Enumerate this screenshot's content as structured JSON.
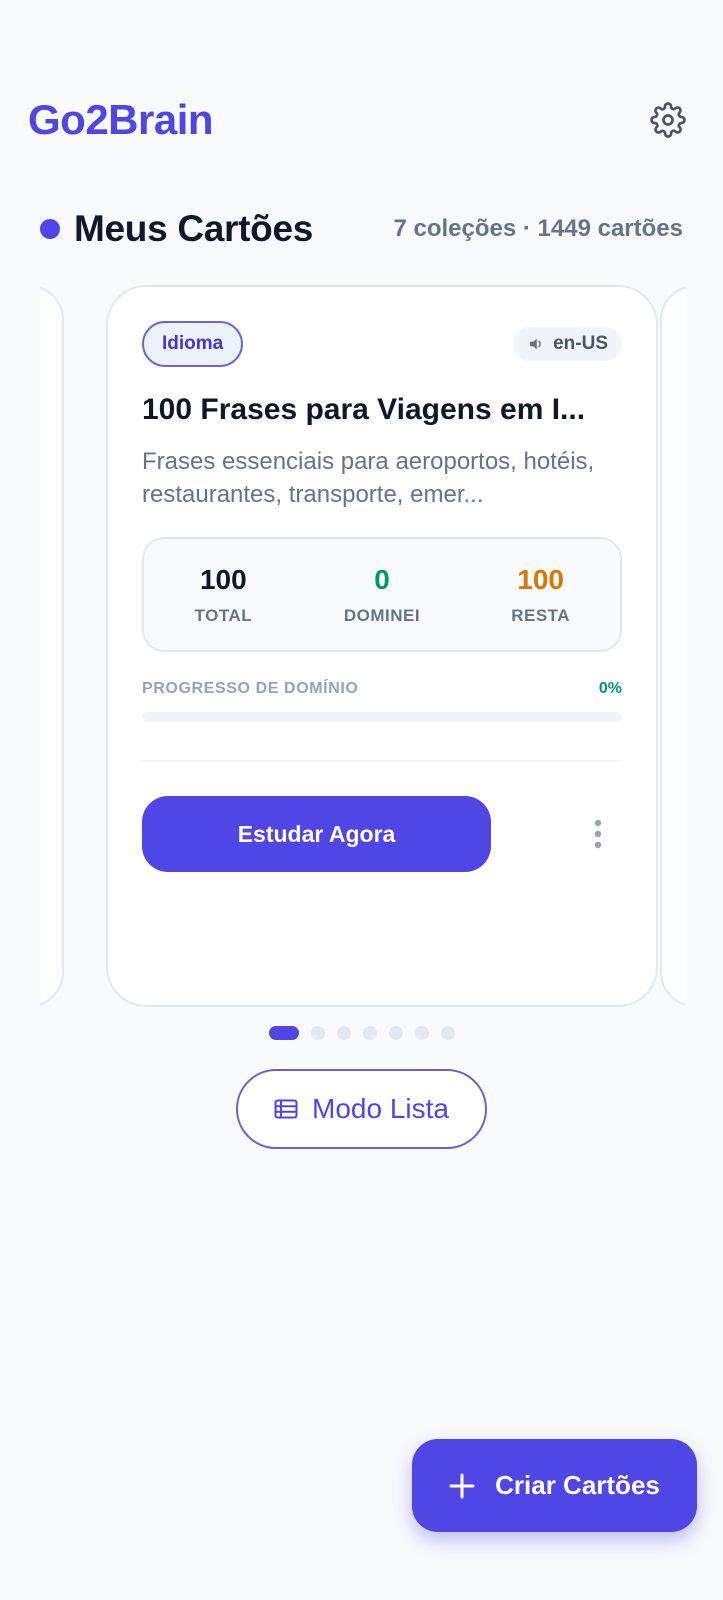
{
  "app": {
    "title": "Go2Brain"
  },
  "header": {
    "settings_icon": "gear-icon"
  },
  "section": {
    "title": "Meus Cartões",
    "meta": "7 coleções · 1449 cartões"
  },
  "card": {
    "badge": "Idioma",
    "language": "en-US",
    "title": "100 Frases para Viagens em I...",
    "description": "Frases essenciais para aeroportos, hotéis, restaurantes, transporte, emer...",
    "stats": {
      "total_value": "100",
      "total_label": "TOTAL",
      "mastered_value": "0",
      "mastered_label": "DOMINEI",
      "remaining_value": "100",
      "remaining_label": "RESTA"
    },
    "progress": {
      "label": "PROGRESSO DE DOMÍNIO",
      "percent_text": "0%",
      "fraction": 0
    },
    "study_button": "Estudar Agora"
  },
  "pagination": {
    "total": 7,
    "active_index": 0
  },
  "list_mode_button": "Modo Lista",
  "fab": {
    "label": "Criar Cartões"
  },
  "colors": {
    "accent": "#4f46e5",
    "green": "#059669",
    "orange": "#d97706",
    "text": "#0f172a",
    "muted": "#64748b"
  }
}
